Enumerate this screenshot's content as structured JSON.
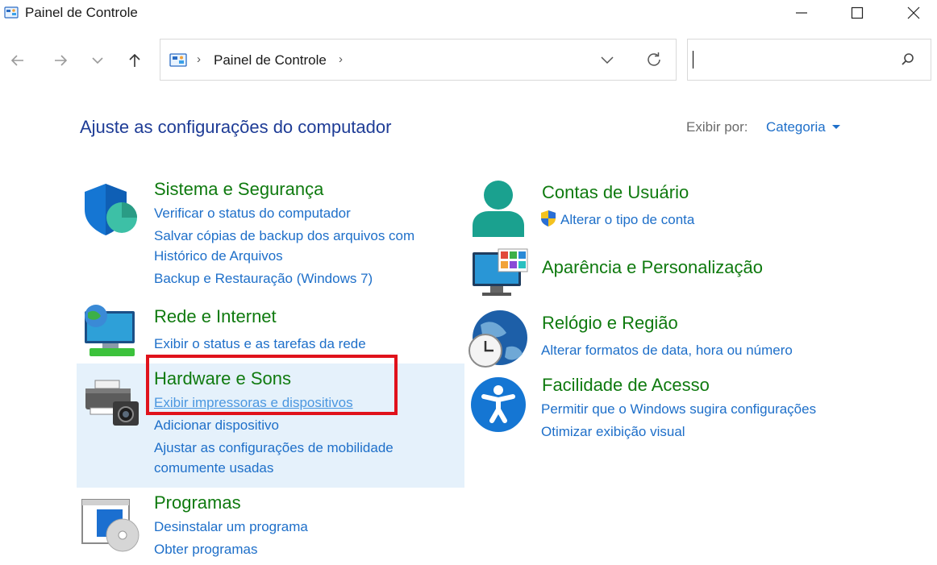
{
  "window": {
    "title": "Painel de Controle"
  },
  "address": {
    "crumb": "Painel de Controle",
    "search_value": ""
  },
  "header": {
    "title": "Ajuste as configurações do computador",
    "view_by_label": "Exibir por:",
    "view_by_value": "Categoria"
  },
  "categories": {
    "system": {
      "title": "Sistema e Segurança",
      "links": [
        "Verificar o status do computador",
        "Salvar cópias de backup dos arquivos com",
        "Histórico de Arquivos",
        "Backup e Restauração (Windows 7)"
      ]
    },
    "network": {
      "title": "Rede e Internet",
      "links": [
        "Exibir o status e as tarefas da rede"
      ]
    },
    "hardware": {
      "title": "Hardware e Sons",
      "links": [
        "Exibir impressoras e dispositivos",
        "Adicionar dispositivo",
        "Ajustar as configurações de mobilidade",
        "comumente usadas"
      ]
    },
    "programs": {
      "title": "Programas",
      "links": [
        "Desinstalar um programa",
        "Obter programas"
      ]
    },
    "accounts": {
      "title": "Contas de Usuário",
      "links": [
        "Alterar o tipo de conta"
      ]
    },
    "appearance": {
      "title": "Aparência e Personalização",
      "links": []
    },
    "clock": {
      "title": "Relógio e Região",
      "links": [
        "Alterar formatos de data, hora ou número"
      ]
    },
    "ease": {
      "title": "Facilidade de Acesso",
      "links": [
        "Permitir que o Windows sugira configurações",
        "Otimizar exibição visual"
      ]
    }
  },
  "icons": {
    "app": "control-panel-icon",
    "back": "arrow-left-icon",
    "forward": "arrow-right-icon",
    "recent": "chevron-down-icon",
    "up": "arrow-up-icon",
    "refresh": "refresh-icon",
    "search": "search-icon"
  },
  "colors": {
    "category_title": "#0f7a0f",
    "link": "#1e6fc9",
    "heading": "#1e3c96",
    "highlight": "#e5f1fb",
    "annotation": "#e0121b"
  }
}
